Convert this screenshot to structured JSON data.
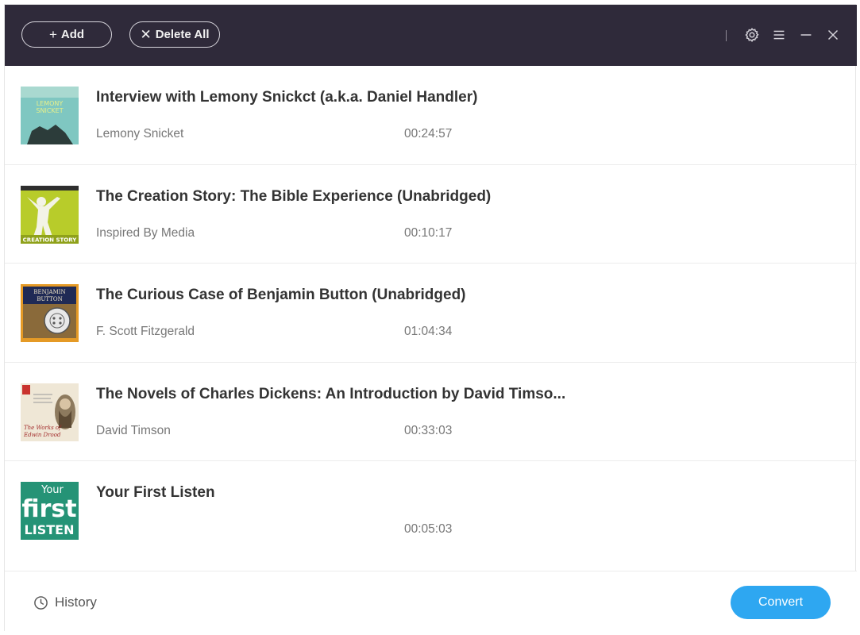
{
  "toolbar": {
    "add_label": "Add",
    "add_icon": "plus-icon",
    "delete_all_label": "Delete All",
    "delete_icon": "x-icon",
    "icons": [
      "gear-icon",
      "menu-icon",
      "minimize-icon",
      "close-icon"
    ],
    "background_color": "#2f2a3a"
  },
  "audiobooks": [
    {
      "title": "Interview with Lemony Snickct (a.k.a. Daniel Handler)",
      "author": "Lemony Snicket",
      "duration": "00:24:57",
      "cover_text": [
        "LEMONY",
        "SNICKET"
      ]
    },
    {
      "title": "The Creation Story: The Bible Experience (Unabridged)",
      "author": "Inspired By Media",
      "duration": "00:10:17",
      "cover_text": [
        "CREATION STORY"
      ]
    },
    {
      "title": "The Curious Case of Benjamin Button (Unabridged)",
      "author": "F. Scott Fitzgerald",
      "duration": "01:04:34",
      "cover_text": [
        "BENJAMIN",
        "BUTTON"
      ]
    },
    {
      "title": "The Novels of Charles Dickens: An Introduction by David Timso...",
      "author": "David Timson",
      "duration": "00:33:03",
      "cover_text": [
        "The Works of",
        "Edwin Drood"
      ]
    },
    {
      "title": "Your First Listen",
      "author": "",
      "duration": "00:05:03",
      "cover_text": [
        "Your",
        "first",
        "LISTEN"
      ]
    }
  ],
  "footer": {
    "history_label": "History",
    "history_icon": "clock-icon",
    "convert_label": "Convert",
    "convert_color": "#2ea7f1"
  }
}
